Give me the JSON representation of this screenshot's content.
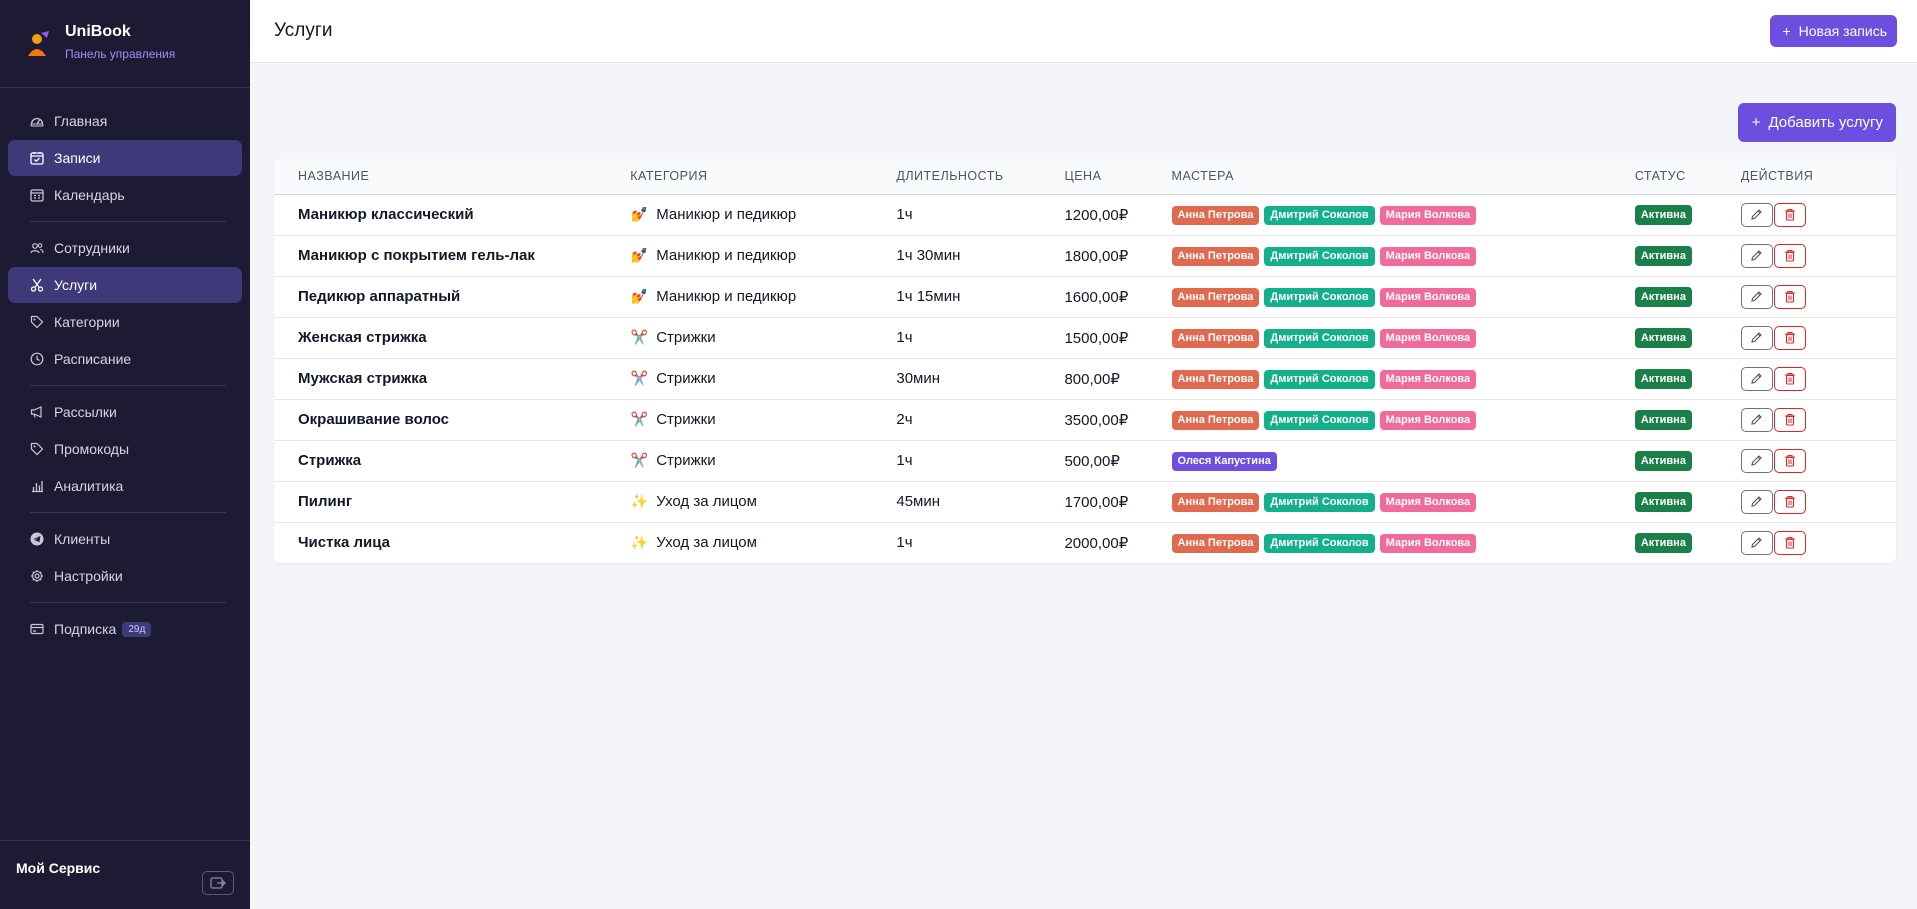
{
  "brand": {
    "name": "UniBook",
    "subtitle": "Панель управления"
  },
  "nav": {
    "groups": [
      [
        {
          "label": "Главная",
          "icon": "dashboard-icon",
          "active": false
        },
        {
          "label": "Записи",
          "icon": "calendar-check-icon",
          "active": true
        },
        {
          "label": "Календарь",
          "icon": "calendar-grid-icon",
          "active": false
        }
      ],
      [
        {
          "label": "Сотрудники",
          "icon": "users-icon",
          "active": false
        },
        {
          "label": "Услуги",
          "icon": "scissors-icon",
          "active": true
        },
        {
          "label": "Категории",
          "icon": "tag-icon",
          "active": false
        },
        {
          "label": "Расписание",
          "icon": "clock-icon",
          "active": false
        }
      ],
      [
        {
          "label": "Рассылки",
          "icon": "megaphone-icon",
          "active": false
        },
        {
          "label": "Промокоды",
          "icon": "tag-icon",
          "active": false
        },
        {
          "label": "Аналитика",
          "icon": "bar-chart-icon",
          "active": false
        }
      ],
      [
        {
          "label": "Клиенты",
          "icon": "telegram-icon",
          "active": false
        },
        {
          "label": "Настройки",
          "icon": "gear-icon",
          "active": false
        }
      ],
      [
        {
          "label": "Подписка",
          "icon": "credit-card-icon",
          "active": false,
          "badge": "29д"
        }
      ]
    ]
  },
  "footer": {
    "name": "Мой Сервис"
  },
  "header": {
    "title": "Услуги",
    "new_button": "Новая запись"
  },
  "add_button": "Добавить услугу",
  "table": {
    "columns": [
      "Название",
      "Категория",
      "Длительность",
      "Цена",
      "Мастера",
      "Статус",
      "Действия"
    ],
    "rows": [
      {
        "name": "Маникюр классический",
        "category_emoji": "💅",
        "category": "Маникюр и педикюр",
        "duration": "1ч",
        "price": "1200,00₽",
        "masters": [
          "Анна Петрова",
          "Дмитрий Соколов",
          "Мария Волкова"
        ],
        "status": "Активна"
      },
      {
        "name": "Маникюр с покрытием гель-лак",
        "category_emoji": "💅",
        "category": "Маникюр и педикюр",
        "duration": "1ч 30мин",
        "price": "1800,00₽",
        "masters": [
          "Анна Петрова",
          "Дмитрий Соколов",
          "Мария Волкова"
        ],
        "status": "Активна"
      },
      {
        "name": "Педикюр аппаратный",
        "category_emoji": "💅",
        "category": "Маникюр и педикюр",
        "duration": "1ч 15мин",
        "price": "1600,00₽",
        "masters": [
          "Анна Петрова",
          "Дмитрий Соколов",
          "Мария Волкова"
        ],
        "status": "Активна"
      },
      {
        "name": "Женская стрижка",
        "category_emoji": "✂️",
        "category": "Стрижки",
        "duration": "1ч",
        "price": "1500,00₽",
        "masters": [
          "Анна Петрова",
          "Дмитрий Соколов",
          "Мария Волкова"
        ],
        "status": "Активна"
      },
      {
        "name": "Мужская стрижка",
        "category_emoji": "✂️",
        "category": "Стрижки",
        "duration": "30мин",
        "price": "800,00₽",
        "masters": [
          "Анна Петрова",
          "Дмитрий Соколов",
          "Мария Волкова"
        ],
        "status": "Активна"
      },
      {
        "name": "Окрашивание волос",
        "category_emoji": "✂️",
        "category": "Стрижки",
        "duration": "2ч",
        "price": "3500,00₽",
        "masters": [
          "Анна Петрова",
          "Дмитрий Соколов",
          "Мария Волкова"
        ],
        "status": "Активна"
      },
      {
        "name": "Стрижка",
        "category_emoji": "✂️",
        "category": "Стрижки",
        "duration": "1ч",
        "price": "500,00₽",
        "masters": [
          "Олеся Капустина"
        ],
        "status": "Активна"
      },
      {
        "name": "Пилинг",
        "category_emoji": "✨",
        "category": "Уход за лицом",
        "duration": "45мин",
        "price": "1700,00₽",
        "masters": [
          "Анна Петрова",
          "Дмитрий Соколов",
          "Мария Волкова"
        ],
        "status": "Активна"
      },
      {
        "name": "Чистка лица",
        "category_emoji": "✨",
        "category": "Уход за лицом",
        "duration": "1ч",
        "price": "2000,00₽",
        "masters": [
          "Анна Петрова",
          "Дмитрий Соколов",
          "Мария Волкова"
        ],
        "status": "Активна"
      }
    ]
  },
  "master_colors": {
    "Анна Петрова": "#e06a4f",
    "Дмитрий Соколов": "#14b08c",
    "Мария Волкова": "#f06a9a",
    "Олеся Капустина": "#6d4fe0"
  },
  "colors": {
    "accent": "#6d4fe0",
    "sidebar_bg": "#1c1b33",
    "status_active": "#1b7f4a"
  }
}
